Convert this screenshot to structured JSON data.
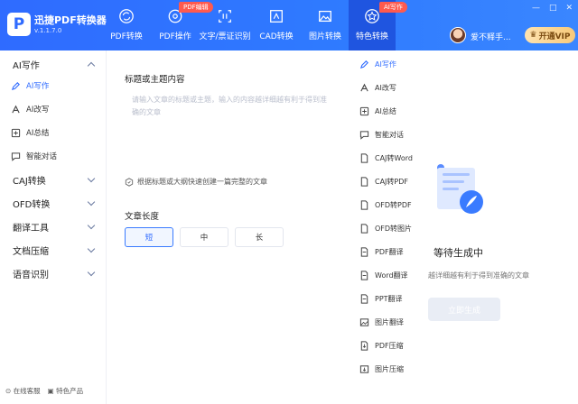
{
  "app": {
    "name": "迅捷PDF转换器",
    "version": "v.1.1.7.0",
    "logo_letter": "P"
  },
  "nav": {
    "tabs": [
      {
        "label": "PDF转换",
        "icon": "refresh-icon"
      },
      {
        "label": "PDF操作",
        "icon": "gear-icon",
        "badge": "PDF编辑"
      },
      {
        "label": "文字/票证识别",
        "icon": "scan-icon"
      },
      {
        "label": "CAD转换",
        "icon": "cad-icon"
      },
      {
        "label": "图片转换",
        "icon": "image-icon"
      },
      {
        "label": "特色转换",
        "icon": "star-icon",
        "badge": "AI写作",
        "active": true
      }
    ]
  },
  "user": {
    "name": "爱不释手...",
    "vip_label": "开通VIP"
  },
  "window": {
    "minimize": "—",
    "maximize": "□",
    "close": "✕"
  },
  "sidebar": {
    "groups": [
      {
        "label": "AI写作",
        "expanded": true,
        "items": [
          {
            "label": "AI写作",
            "icon": "pen-icon",
            "active": true
          },
          {
            "label": "AI改写",
            "icon": "rewrite-icon"
          },
          {
            "label": "AI总结",
            "icon": "summary-icon"
          },
          {
            "label": "智能对话",
            "icon": "chat-icon"
          }
        ]
      },
      {
        "label": "CAJ转换"
      },
      {
        "label": "OFD转换"
      },
      {
        "label": "翻译工具"
      },
      {
        "label": "文档压缩"
      },
      {
        "label": "语音识别"
      }
    ],
    "bottom_links": [
      "在线客服",
      "特色产品"
    ]
  },
  "main": {
    "topic_label": "标题或主题内容",
    "topic_placeholder": "请输入文章的标题或主题，输入的内容越详细越有利于得到准确的文章",
    "tip": "根据标题或大纲快速创建一篇完整的文章",
    "length_label": "文章长度",
    "length_options": [
      "短",
      "中",
      "长"
    ],
    "length_selected": "短"
  },
  "right_list": [
    {
      "label": "AI写作",
      "active": true
    },
    {
      "label": "AI改写"
    },
    {
      "label": "AI总结"
    },
    {
      "label": "智能对话"
    },
    {
      "label": "CAJ转Word"
    },
    {
      "label": "CAJ转PDF"
    },
    {
      "label": "OFD转PDF"
    },
    {
      "label": "OFD转图片"
    },
    {
      "label": "PDF翻译"
    },
    {
      "label": "Word翻译"
    },
    {
      "label": "PPT翻译"
    },
    {
      "label": "图片翻译"
    },
    {
      "label": "PDF压缩"
    },
    {
      "label": "图片压缩"
    }
  ],
  "status": {
    "title": "等待生成中",
    "description": "越详细越有利于得到准确的文章",
    "generate_label": "立即生成"
  },
  "colors": {
    "primary": "#2f6bff",
    "badge": "#ff5a4e",
    "vip": "#f7c97a"
  }
}
